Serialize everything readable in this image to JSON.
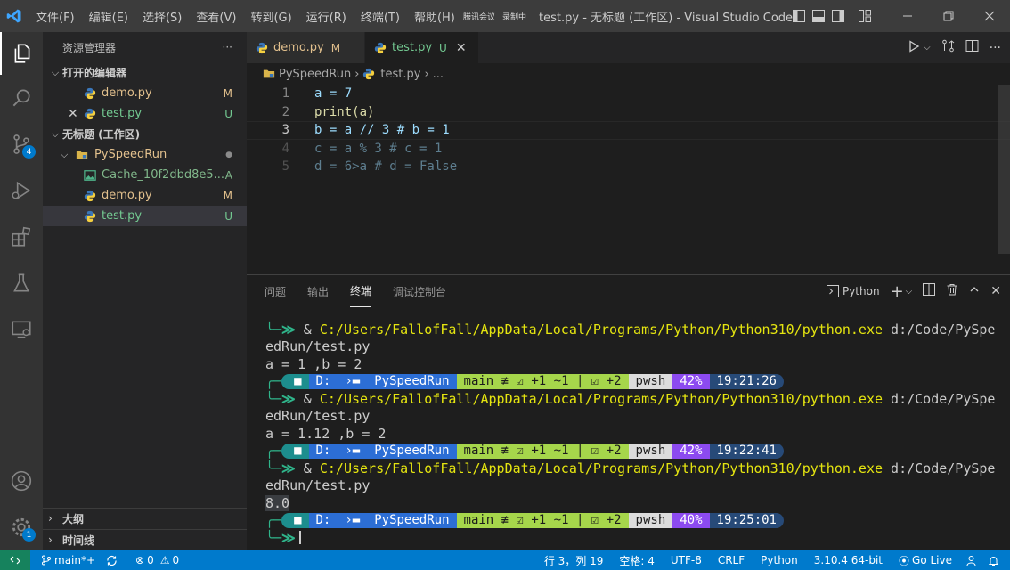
{
  "menu": [
    "文件(F)",
    "编辑(E)",
    "选择(S)",
    "查看(V)",
    "转到(G)",
    "运行(R)",
    "终端(T)",
    "帮助(H)"
  ],
  "meeting": {
    "app": "腾讯会议",
    "recording": "录制中"
  },
  "window_title": "test.py - 无标题 (工作区) - Visual Studio Code",
  "activity": {
    "scm_badge": "4",
    "settings_badge": "1"
  },
  "sidebar": {
    "header": "资源管理器",
    "more": "···",
    "open_editors": {
      "label": "打开的编辑器",
      "items": [
        {
          "name": "demo.py",
          "deco": "M"
        },
        {
          "name": "test.py",
          "deco": "U"
        }
      ]
    },
    "workspace": {
      "label": "无标题 (工作区)",
      "folder": "PySpeedRun",
      "folder_deco": "●",
      "items": [
        {
          "name": "Cache_10f2dbd8e5...",
          "deco": "A"
        },
        {
          "name": "demo.py",
          "deco": "M"
        },
        {
          "name": "test.py",
          "deco": "U"
        }
      ]
    },
    "outline": "大纲",
    "timeline": "时间线"
  },
  "tabs": [
    {
      "name": "demo.py",
      "deco": "M"
    },
    {
      "name": "test.py",
      "deco": "U"
    }
  ],
  "breadcrumb": {
    "folder": "PySpeedRun",
    "file": "test.py",
    "rest": "..."
  },
  "code_lines": [
    {
      "num": "1",
      "text": "a = 7"
    },
    {
      "num": "2",
      "text": "print(a)"
    },
    {
      "num": "3",
      "text": "b = a // 3 # b = 1"
    },
    {
      "num": "4",
      "text": "c = a % 3 # c = 1"
    },
    {
      "num": "5",
      "text": "d = 6>a # d = False"
    }
  ],
  "panel": {
    "tabs": [
      "问题",
      "输出",
      "终端",
      "调试控制台"
    ],
    "active_tab": "终端",
    "terminal_selector": "Python"
  },
  "terminal": {
    "cmd_prefix": "& ",
    "cmd_path": "C:/Users/FallofFall/AppData/Local/Programs/Python/Python310/python.exe",
    "cmd_arg1": " d:/Code/PySpe",
    "cmd_arg2": "edRun/test.py",
    "outputs": [
      "a = 1 ,b = 2",
      "a = 1.12 ,b = 2",
      "8.0"
    ],
    "prompt": {
      "drive": "D:",
      "folder": "PySpeedRun",
      "git": "main ≢ ☑ +1 ~1 | ☑ +2",
      "shell": "pwsh"
    },
    "prompts": [
      {
        "battery": "42%",
        "time": "19:21:26"
      },
      {
        "battery": "42%",
        "time": "19:22:41"
      },
      {
        "battery": "40%",
        "time": "19:25:01"
      }
    ]
  },
  "status": {
    "branch": "main*+",
    "errors": "0",
    "warnings": "0",
    "position": "行 3，列 19",
    "spaces": "空格: 4",
    "encoding": "UTF-8",
    "eol": "CRLF",
    "language": "Python",
    "interpreter": "3.10.4 64-bit",
    "golive": "Go Live"
  }
}
